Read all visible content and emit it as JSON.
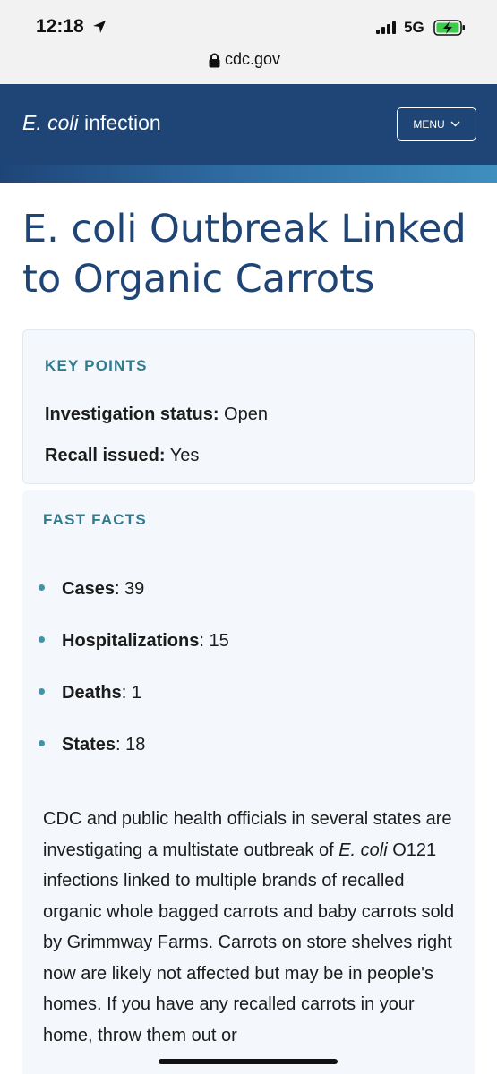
{
  "status_bar": {
    "time": "12:18",
    "carrier": "5G"
  },
  "url_bar": {
    "url": "cdc.gov"
  },
  "site_header": {
    "title_italic": "E. coli",
    "title_rest": " infection",
    "menu_label": "MENU"
  },
  "page_title": "E. coli Outbreak Linked to Organic Carrots",
  "key_points": {
    "heading": "KEY POINTS",
    "items": [
      {
        "label": "Investigation status:",
        "value": " Open"
      },
      {
        "label": "Recall issued:",
        "value": " Yes"
      }
    ]
  },
  "fast_facts": {
    "heading": "FAST FACTS",
    "items": [
      {
        "label": "Cases",
        "value": ": 39"
      },
      {
        "label": "Hospitalizations",
        "value": ": 15"
      },
      {
        "label": "Deaths",
        "value": ": 1"
      },
      {
        "label": "States",
        "value": ": 18"
      }
    ]
  },
  "body": {
    "part1": "CDC and public health officials in several states are investigating a multistate outbreak of ",
    "italic": "E. coli",
    "part2": " O121 infections linked to multiple brands of recalled organic whole bagged carrots and baby carrots sold by Grimmway Farms. Carrots on store shelves right now are likely not affected but may be in people's homes. If you have any recalled carrots in your home, throw them out or"
  }
}
